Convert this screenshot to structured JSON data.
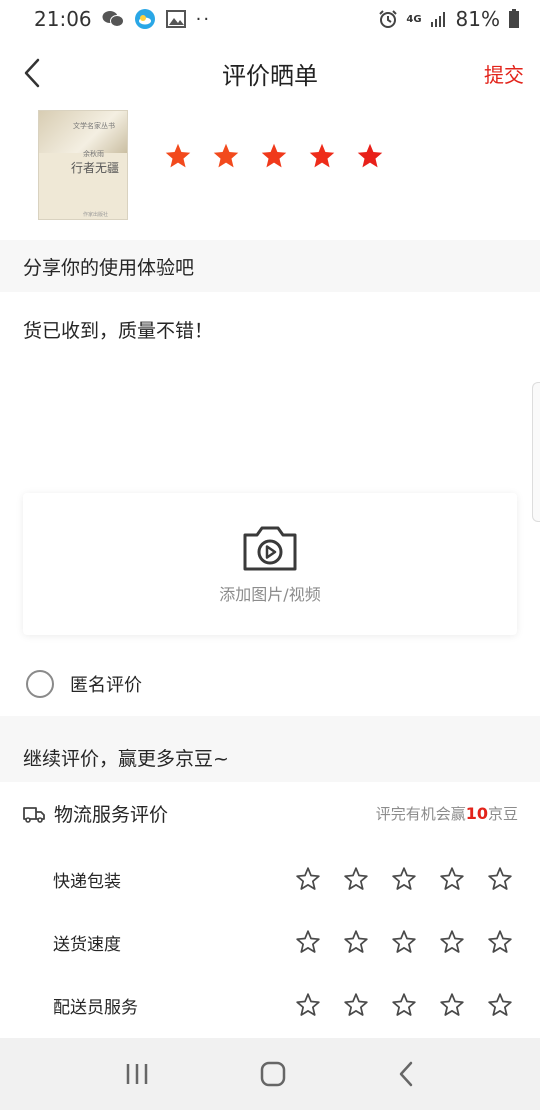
{
  "status_bar": {
    "time": "21:06",
    "network": "4G",
    "battery": "81%"
  },
  "header": {
    "title": "评价晒单",
    "submit_label": "提交"
  },
  "product": {
    "cover_small_text": "文学名家丛书",
    "cover_author": "余秋雨",
    "cover_title": "行者无疆",
    "cover_publisher": "作家出版社",
    "rating_stars": 5
  },
  "review": {
    "prompt": "分享你的使用体验吧",
    "text": "货已收到，质量不错！"
  },
  "upload": {
    "label": "添加图片/视频"
  },
  "anonymous": {
    "label": "匿名评价",
    "checked": false
  },
  "continue": {
    "label": "继续评价，赢更多京豆~"
  },
  "logistics": {
    "title": "物流服务评价",
    "hint_prefix": "评完有机会赢",
    "hint_number": "10",
    "hint_suffix": "京豆",
    "items": [
      {
        "label": "快递包装",
        "rating": 0
      },
      {
        "label": "送货速度",
        "rating": 0
      },
      {
        "label": "配送员服务",
        "rating": 0
      }
    ]
  },
  "colors": {
    "accent": "#e2231a",
    "star_filled": "#f24a1d"
  }
}
